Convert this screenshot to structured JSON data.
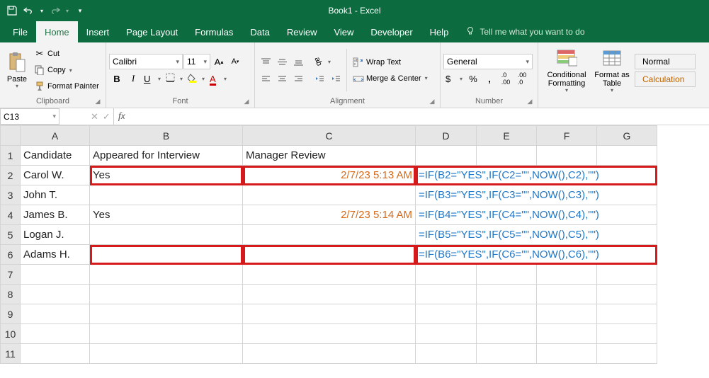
{
  "title": "Book1 - Excel",
  "tabs": [
    "File",
    "Home",
    "Insert",
    "Page Layout",
    "Formulas",
    "Data",
    "Review",
    "View",
    "Developer",
    "Help"
  ],
  "tellme": "Tell me what you want to do",
  "clipboard": {
    "paste": "Paste",
    "cut": "Cut",
    "copy": "Copy",
    "painter": "Format Painter",
    "label": "Clipboard"
  },
  "font": {
    "name": "Calibri",
    "size": "11",
    "bold": "B",
    "italic": "I",
    "underline": "U",
    "label": "Font"
  },
  "alignment": {
    "wrap": "Wrap Text",
    "merge": "Merge & Center",
    "label": "Alignment"
  },
  "number": {
    "format": "General",
    "label": "Number"
  },
  "styles": {
    "cond": "Conditional Formatting",
    "table": "Format as Table",
    "normal": "Normal",
    "calc": "Calculation"
  },
  "namebox": "C13",
  "fx": "",
  "cols": [
    "A",
    "B",
    "C",
    "D",
    "E",
    "F",
    "G"
  ],
  "rows": [
    "1",
    "2",
    "3",
    "4",
    "5",
    "6",
    "7",
    "8",
    "9",
    "10",
    "11"
  ],
  "cells": {
    "A1": "Candidate",
    "B1": "Appeared for Interview",
    "C1": "Manager Review",
    "A2": "Carol W.",
    "B2": "Yes",
    "C2": "2/7/23 5:13 AM",
    "D2": "=IF(B2=\"YES\",IF(C2=\"\",NOW(),C2),\"\")",
    "A3": "John T.",
    "D3": "=IF(B3=\"YES\",IF(C3=\"\",NOW(),C3),\"\")",
    "A4": "James B.",
    "B4": "Yes",
    "C4": "2/7/23 5:14 AM",
    "D4": "=IF(B4=\"YES\",IF(C4=\"\",NOW(),C4),\"\")",
    "A5": "Logan J.",
    "D5": "=IF(B5=\"YES\",IF(C5=\"\",NOW(),C5),\"\")",
    "A6": "Adams H.",
    "D6": "=IF(B6=\"YES\",IF(C6=\"\",NOW(),C6),\"\")"
  }
}
